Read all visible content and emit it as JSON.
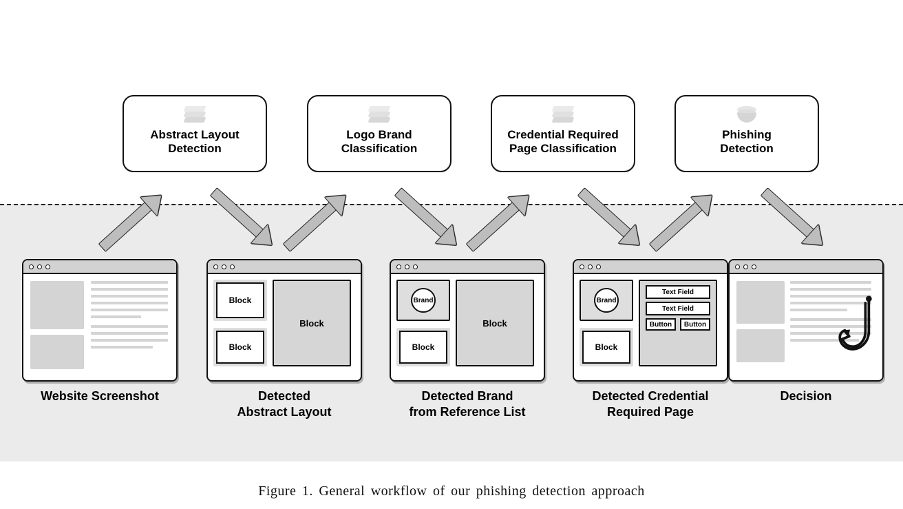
{
  "process_boxes": [
    {
      "id": "abstract-layout",
      "label_l1": "Abstract Layout",
      "label_l2": "Detection",
      "icon": "stack"
    },
    {
      "id": "logo-brand",
      "label_l1": "Logo Brand",
      "label_l2": "Classification",
      "icon": "stack"
    },
    {
      "id": "cred-page",
      "label_l1": "Credential Required",
      "label_l2": "Page Classification",
      "icon": "stack"
    },
    {
      "id": "phish-detect",
      "label_l1": "Phishing",
      "label_l2": "Detection",
      "icon": "cylinder"
    }
  ],
  "stages": [
    {
      "id": "screenshot",
      "caption_l1": "Website Screenshot",
      "caption_l2": ""
    },
    {
      "id": "abstract",
      "caption_l1": "Detected",
      "caption_l2": "Abstract Layout"
    },
    {
      "id": "brand",
      "caption_l1": "Detected Brand",
      "caption_l2": "from Reference List"
    },
    {
      "id": "credential",
      "caption_l1": "Detected Credential",
      "caption_l2": "Required Page"
    },
    {
      "id": "decision",
      "caption_l1": "Decision",
      "caption_l2": ""
    }
  ],
  "mock_labels": {
    "block": "Block",
    "brand": "Brand",
    "text_field": "Text Field",
    "button": "Button"
  },
  "figure_caption": "Figure 1. General workflow of our phishing detection approach"
}
